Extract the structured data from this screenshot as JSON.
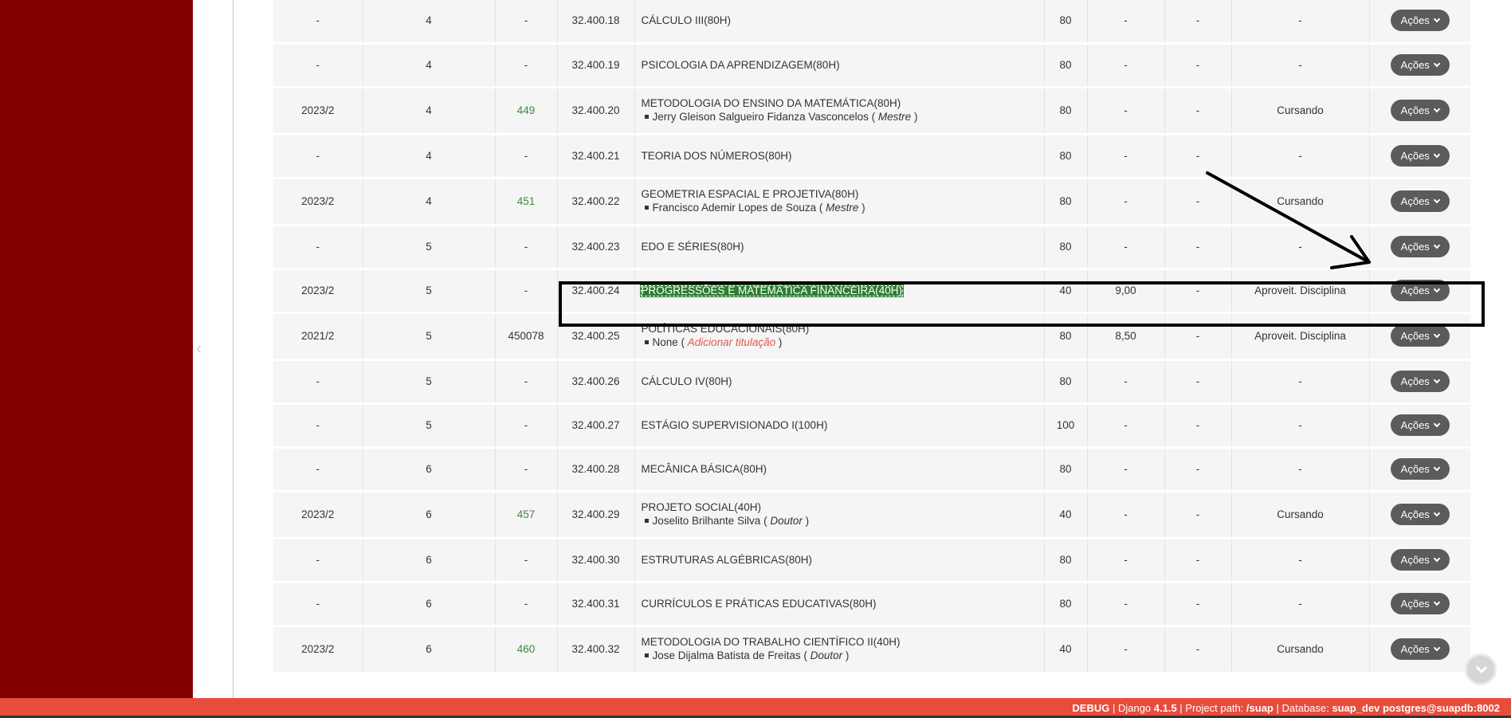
{
  "rows": [
    {
      "periodo_letivo": "-",
      "periodo": "4",
      "diario": "-",
      "sigla": "32.400.18",
      "disciplina": "CÁLCULO III(80H)",
      "professor": null,
      "ch": "80",
      "nota": "-",
      "freq": "-",
      "situacao": "-",
      "acoes": "Ações"
    },
    {
      "periodo_letivo": "-",
      "periodo": "4",
      "diario": "-",
      "sigla": "32.400.19",
      "disciplina": "PSICOLOGIA DA APRENDIZAGEM(80H)",
      "professor": null,
      "ch": "80",
      "nota": "-",
      "freq": "-",
      "situacao": "-",
      "acoes": "Ações"
    },
    {
      "periodo_letivo": "2023/2",
      "periodo": "4",
      "diario": "449",
      "sigla": "32.400.20",
      "disciplina": "METODOLOGIA DO ENSINO DA MATEMÁTICA(80H)",
      "professor": {
        "name": "Jerry Gleison Salgueiro Fidanza Vasconcelos (",
        "titulacao": "Mestre",
        "close": ")"
      },
      "ch": "80",
      "nota": "-",
      "freq": "-",
      "situacao": "Cursando",
      "acoes": "Ações"
    },
    {
      "periodo_letivo": "-",
      "periodo": "4",
      "diario": "-",
      "sigla": "32.400.21",
      "disciplina": "TEORIA DOS NÚMEROS(80H)",
      "professor": null,
      "ch": "80",
      "nota": "-",
      "freq": "-",
      "situacao": "-",
      "acoes": "Ações"
    },
    {
      "periodo_letivo": "2023/2",
      "periodo": "4",
      "diario": "451",
      "sigla": "32.400.22",
      "disciplina": "GEOMETRIA ESPACIAL E PROJETIVA(80H)",
      "professor": {
        "name": "Francisco Ademir Lopes de Souza (",
        "titulacao": "Mestre",
        "close": ")"
      },
      "ch": "80",
      "nota": "-",
      "freq": "-",
      "situacao": "Cursando",
      "acoes": "Ações"
    },
    {
      "periodo_letivo": "-",
      "periodo": "5",
      "diario": "-",
      "sigla": "32.400.23",
      "disciplina": "EDO E SÉRIES(80H)",
      "professor": null,
      "ch": "80",
      "nota": "-",
      "freq": "-",
      "situacao": "-",
      "acoes": "Ações"
    },
    {
      "periodo_letivo": "2023/2",
      "periodo": "5",
      "diario": "-",
      "sigla": "32.400.24",
      "disciplina": "PROGRESSÕES E MATEMÁTICA FINANCEIRA(40H)",
      "highlight": true,
      "professor": null,
      "ch": "40",
      "nota": "9,00",
      "freq": "-",
      "situacao": "Aproveit. Disciplina",
      "acoes": "Ações"
    },
    {
      "periodo_letivo": "2021/2",
      "periodo": "5",
      "diario": "450078",
      "sigla": "32.400.25",
      "disciplina": "POLÍTICAS EDUCACIONAIS(80H)",
      "professor": {
        "name": "None (",
        "titulacao": "Adicionar titulação",
        "link": true,
        "close": ")"
      },
      "ch": "80",
      "nota": "8,50",
      "freq": "-",
      "situacao": "Aproveit. Disciplina",
      "acoes": "Ações"
    },
    {
      "periodo_letivo": "-",
      "periodo": "5",
      "diario": "-",
      "sigla": "32.400.26",
      "disciplina": "CÁLCULO IV(80H)",
      "professor": null,
      "ch": "80",
      "nota": "-",
      "freq": "-",
      "situacao": "-",
      "acoes": "Ações"
    },
    {
      "periodo_letivo": "-",
      "periodo": "5",
      "diario": "-",
      "sigla": "32.400.27",
      "disciplina": "ESTÁGIO SUPERVISIONADO I(100H)",
      "professor": null,
      "ch": "100",
      "nota": "-",
      "freq": "-",
      "situacao": "-",
      "acoes": "Ações"
    },
    {
      "periodo_letivo": "-",
      "periodo": "6",
      "diario": "-",
      "sigla": "32.400.28",
      "disciplina": "MECÂNICA BÁSICA(80H)",
      "professor": null,
      "ch": "80",
      "nota": "-",
      "freq": "-",
      "situacao": "-",
      "acoes": "Ações"
    },
    {
      "periodo_letivo": "2023/2",
      "periodo": "6",
      "diario": "457",
      "sigla": "32.400.29",
      "disciplina": "PROJETO SOCIAL(40H)",
      "professor": {
        "name": "Joselito Brilhante Silva (",
        "titulacao": "Doutor",
        "close": ")"
      },
      "ch": "40",
      "nota": "-",
      "freq": "-",
      "situacao": "Cursando",
      "acoes": "Ações"
    },
    {
      "periodo_letivo": "-",
      "periodo": "6",
      "diario": "-",
      "sigla": "32.400.30",
      "disciplina": "ESTRUTURAS ALGÉBRICAS(80H)",
      "professor": null,
      "ch": "80",
      "nota": "-",
      "freq": "-",
      "situacao": "-",
      "acoes": "Ações"
    },
    {
      "periodo_letivo": "-",
      "periodo": "6",
      "diario": "-",
      "sigla": "32.400.31",
      "disciplina": "CURRÍCULOS E PRÁTICAS EDUCATIVAS(80H)",
      "professor": null,
      "ch": "80",
      "nota": "-",
      "freq": "-",
      "situacao": "-",
      "acoes": "Ações"
    },
    {
      "periodo_letivo": "2023/2",
      "periodo": "6",
      "diario": "460",
      "sigla": "32.400.32",
      "disciplina": "METODOLOGIA DO TRABALHO CIENTÍFICO II(40H)",
      "professor": {
        "name": "Jose Dijalma Batista de Freitas (",
        "titulacao": "Doutor",
        "close": ")"
      },
      "ch": "40",
      "nota": "-",
      "freq": "-",
      "situacao": "Cursando",
      "acoes": "Ações"
    }
  ],
  "debug_bar": {
    "debug": "DEBUG",
    "sep": " | ",
    "django_label": "Django ",
    "django_version": "4.1.5",
    "project_label": "Project path: ",
    "project_path": "/suap",
    "db_label": "Database: ",
    "db_value": "suap_dev postgres@suapdb:8002"
  },
  "icons": {
    "collapse": "chevron-left-icon",
    "scroll": "chevron-down-icon",
    "acoes": "chevron-down-icon"
  },
  "colors": {
    "sidebar": "#820000",
    "debug_bar": "#e84c3d",
    "highlight": "#2f7d32",
    "diario_link": "#3d8b3d",
    "titulacao_link": "#e05a47",
    "button": "#5b5b5b"
  }
}
